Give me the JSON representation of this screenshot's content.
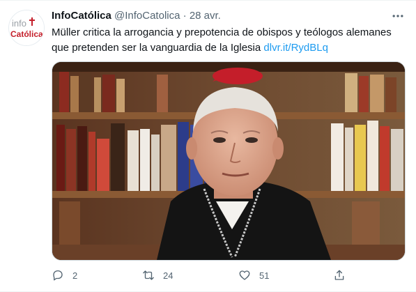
{
  "tweet": {
    "display_name": "InfoCatólica",
    "handle": "@InfoCatolica",
    "separator": "·",
    "date": "28 avr.",
    "text": "Müller critica la arrogancia y prepotencia de obispos y teólogos alemanes que pretenden ser la vanguardia de la Iglesia ",
    "link_text": "dlvr.it/RydBLq",
    "avatar": {
      "line1": "info",
      "line2": "Católica"
    },
    "media_description": "photo of a cardinal in front of bookshelves"
  },
  "actions": {
    "reply_count": "2",
    "retweet_count": "24",
    "like_count": "51"
  },
  "icons": {
    "more": "more-dots-icon",
    "reply": "reply-icon",
    "retweet": "retweet-icon",
    "like": "heart-icon",
    "share": "share-icon"
  },
  "colors": {
    "text": "#0f1419",
    "secondary": "#536471",
    "link": "#1d9bf0",
    "brand_red": "#c41e2a"
  }
}
